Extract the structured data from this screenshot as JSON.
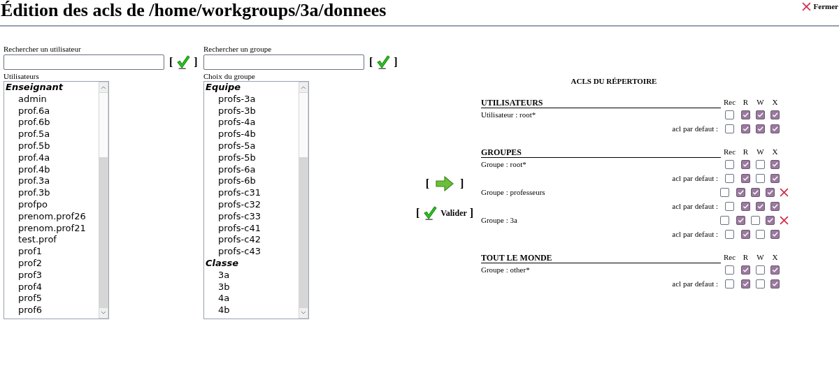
{
  "title": "Édition des acls de /home/workgroups/3a/donnees",
  "close": {
    "label": "Fermer"
  },
  "user_search": {
    "label": "Rechercher un utilisateur",
    "brackets": [
      "[",
      "]"
    ]
  },
  "group_search": {
    "label": "Rechercher un groupe",
    "brackets": [
      "[",
      "]"
    ]
  },
  "users": {
    "label": "Utilisateurs",
    "groups": [
      {
        "name": "Enseignant",
        "items": [
          "admin",
          "prof.6a",
          "prof.6b",
          "prof.5a",
          "prof.5b",
          "prof.4a",
          "prof.4b",
          "prof.3a",
          "prof.3b",
          "profpo",
          "prenom.prof26",
          "prenom.prof21",
          "test.prof",
          "prof1",
          "prof2",
          "prof3",
          "prof4",
          "prof5",
          "prof6"
        ]
      }
    ]
  },
  "groups": {
    "label": "Choix du groupe",
    "groups": [
      {
        "name": "Equipe",
        "items": [
          "profs-3a",
          "profs-3b",
          "profs-4a",
          "profs-4b",
          "profs-5a",
          "profs-5b",
          "profs-6a",
          "profs-6b",
          "profs-c31",
          "profs-c32",
          "profs-c33",
          "profs-c41",
          "profs-c42",
          "profs-c43"
        ]
      },
      {
        "name": "Classe",
        "items": [
          "3a",
          "3b",
          "4a",
          "4b"
        ]
      }
    ]
  },
  "add_button": {
    "kind": "arrow",
    "brackets": [
      "[",
      "]"
    ]
  },
  "validate_button": {
    "label": "Valider",
    "brackets": [
      "[",
      "]"
    ]
  },
  "acls": {
    "title": "ACLS DU RÉPERTOIRE",
    "sections": [
      {
        "title": "UTILISATEURS",
        "columns": [
          "Rec",
          "R",
          "W",
          "X"
        ],
        "entries": [
          {
            "label": "Utilisateur : root*",
            "perms": [
              false,
              true,
              true,
              true
            ],
            "removable": false,
            "default_label": "acl par defaut :",
            "default_perms": [
              false,
              true,
              true,
              true
            ]
          }
        ]
      },
      {
        "title": "GROUPES",
        "columns": [
          "Rec",
          "R",
          "W",
          "X"
        ],
        "entries": [
          {
            "label": "Groupe : root*",
            "perms": [
              false,
              true,
              false,
              true
            ],
            "removable": false,
            "default_label": "acl par defaut :",
            "default_perms": [
              false,
              true,
              false,
              true
            ]
          },
          {
            "label": "Groupe : professeurs",
            "perms": [
              false,
              true,
              true,
              true
            ],
            "removable": true,
            "default_label": "acl par defaut :",
            "default_perms": [
              false,
              true,
              true,
              true
            ]
          },
          {
            "label": "Groupe : 3a",
            "perms": [
              false,
              true,
              false,
              true
            ],
            "removable": true,
            "default_label": "acl par defaut :",
            "default_perms": [
              false,
              true,
              false,
              true
            ]
          }
        ]
      },
      {
        "title": "TOUT LE MONDE",
        "columns": [
          "Rec",
          "R",
          "W",
          "X"
        ],
        "entries": [
          {
            "label": "Groupe : other*",
            "perms": [
              false,
              true,
              false,
              true
            ],
            "removable": false,
            "default_label": "acl par defaut :",
            "default_perms": [
              false,
              true,
              false,
              true
            ]
          }
        ]
      }
    ]
  }
}
